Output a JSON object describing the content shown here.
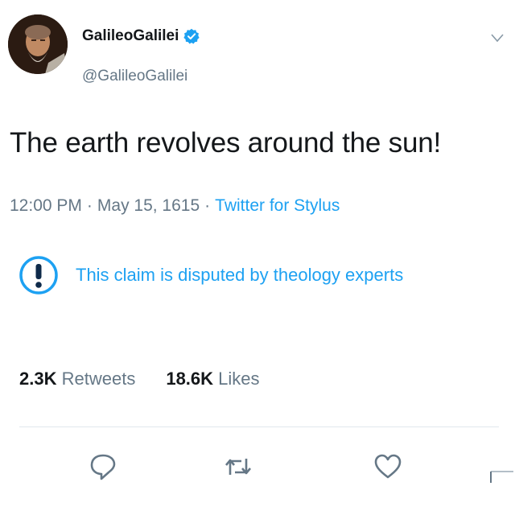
{
  "author": {
    "display_name": "GalileoGalilei",
    "handle": "@GalileoGalilei",
    "verified": true
  },
  "tweet": {
    "text": "The earth revolves around the sun!",
    "time": "12:00 PM",
    "separator": "·",
    "date": "May 15, 1615",
    "source": "Twitter for Stylus"
  },
  "notice": {
    "text": "This claim is disputed by theology experts",
    "icon": "exclamation-circle-icon"
  },
  "stats": {
    "retweets_count": "2.3K",
    "retweets_label": "Retweets",
    "likes_count": "18.6K",
    "likes_label": "Likes"
  },
  "actions": [
    "reply-icon",
    "retweet-icon",
    "like-icon"
  ],
  "colors": {
    "accent": "#1da1f2",
    "text": "#14171a",
    "muted": "#657786"
  }
}
